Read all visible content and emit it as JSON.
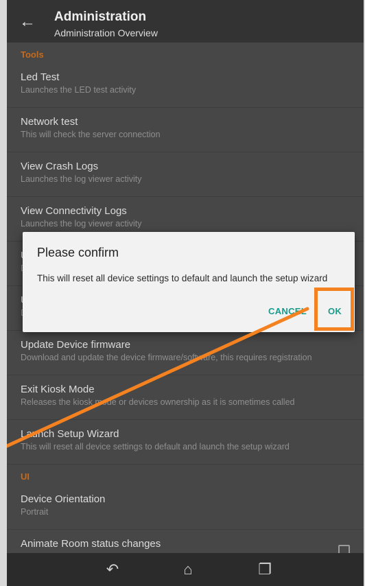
{
  "header": {
    "title": "Administration",
    "subtitle": "Administration Overview"
  },
  "sections": [
    {
      "header": "Tools",
      "items": [
        {
          "title": "Led Test",
          "summary": "Launches the LED test activity"
        },
        {
          "title": "Network test",
          "summary": "This will check the server connection"
        },
        {
          "title": "View Crash Logs",
          "summary": "Launches the log viewer activity"
        },
        {
          "title": "View Connectivity Logs",
          "summary": "Launches the log viewer activity"
        },
        {
          "title": "U",
          "summary": "D"
        },
        {
          "title": "U",
          "summary": "D"
        },
        {
          "title": "Update Device firmware",
          "summary": "Download and update the device firmware/software, this requires registration"
        },
        {
          "title": "Exit Kiosk Mode",
          "summary": "Releases the kiosk mode or devices ownership as it is sometimes called"
        },
        {
          "title": "Launch Setup Wizard",
          "summary": "This will reset all device settings to default and launch the setup wizard"
        }
      ]
    },
    {
      "header": "UI",
      "items": [
        {
          "title": "Device Orientation",
          "summary": "Portrait"
        },
        {
          "title": "Animate Room status changes",
          "summary": ""
        }
      ]
    }
  ],
  "dialog": {
    "title": "Please confirm",
    "message": "This will reset all device settings to default and launch the setup wizard",
    "cancel_label": "CANCEL",
    "ok_label": "OK"
  },
  "colors": {
    "accent": "#1a9b8a",
    "section_header": "#c56b1e",
    "highlight": "#f58220"
  },
  "icons": {
    "back": "arrow-left",
    "nav_back": "back-arrow",
    "nav_home": "home",
    "nav_recents": "recents"
  }
}
